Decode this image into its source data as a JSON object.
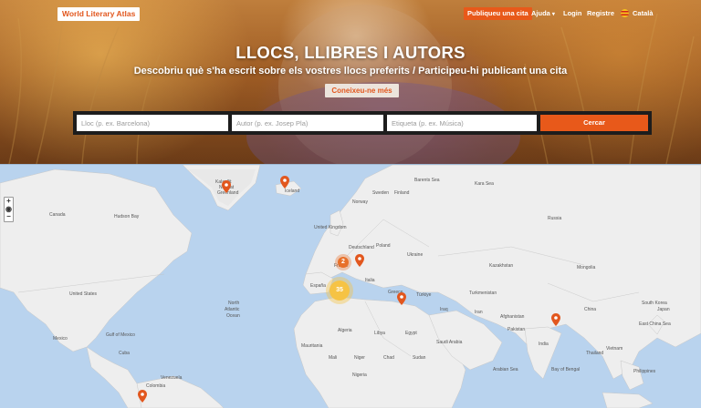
{
  "header": {
    "logo": "World Literary Atlas",
    "publish_button": "Publiqueu una cita",
    "nav": {
      "help": "Ajuda",
      "login": "Login",
      "register": "Registre",
      "language": "Català"
    }
  },
  "hero": {
    "title": "LLOCS, LLIBRES I AUTORS",
    "subtitle": "Descobriu què s'ha escrit sobre els vostres llocs preferits / Participeu-hi publicant una cita",
    "cta": "Coneixeu-ne més"
  },
  "search": {
    "place_placeholder": "Lloc (p. ex. Barcelona)",
    "author_placeholder": "Autor (p. ex. Josep Pla)",
    "tag_placeholder": "Etiqueta (p. ex. Música)",
    "button": "Cercar"
  },
  "map": {
    "zoom_in": "+",
    "zoom_reset": "◉",
    "zoom_out": "−",
    "clusters": [
      {
        "label": "2",
        "color": "#e8702a"
      },
      {
        "label": "35",
        "color": "#f6c344"
      }
    ],
    "labels": {
      "kalaallit": "Kalaallit",
      "nunaat": "Nunaat",
      "greenland": "Greenland",
      "iceland": "Iceland",
      "canada": "Canada",
      "hudson_bay": "Hudson Bay",
      "united_states": "United States",
      "mexico": "Mexico",
      "gulf_of_mexico": "Gulf of Mexico",
      "cuba": "Cuba",
      "venezuela": "Venezuela",
      "colombia": "Colombia",
      "north_atlantic_ocean_1": "North",
      "north_atlantic_ocean_2": "Atlantic",
      "north_atlantic_ocean_3": "Ocean",
      "sweden": "Sweden",
      "norway": "Norway",
      "finland": "Finland",
      "united_kingdom": "United Kingdom",
      "poland": "Poland",
      "germany": "Deutschland",
      "ukraine": "Ukraine",
      "france": "France",
      "spain": "España",
      "italy": "Italia",
      "greece": "Greece",
      "turkey": "Türkiye",
      "algeria": "Algeria",
      "libya": "Libya",
      "egypt": "Egypt",
      "mali": "Mali",
      "niger": "Niger",
      "chad": "Chad",
      "sudan": "Sudan",
      "nigeria": "Nigeria",
      "mauritania": "Mauritania",
      "saudi_arabia": "Saudi Arabia",
      "iran": "Iran",
      "iraq": "Iraq",
      "kazakhstan": "Kazakhstan",
      "russia": "Russia",
      "mongolia": "Mongolia",
      "china": "China",
      "india": "India",
      "turkmenistan": "Turkmenistan",
      "afghanistan": "Afghanistan",
      "pakistan": "Pakistan",
      "thailand": "Thailand",
      "vietnam": "Vietnam",
      "philippines": "Philippines",
      "japan": "Japan",
      "south_korea": "South Korea",
      "barents_sea": "Barents Sea",
      "kara_sea": "Kara Sea",
      "east_china_sea": "East China Sea",
      "bay_of_bengal": "Bay of Bengal",
      "arabian_sea": "Arabian Sea"
    }
  },
  "colors": {
    "accent": "#e8591a",
    "ocean": "#b9d3ee",
    "land": "#efefef"
  }
}
